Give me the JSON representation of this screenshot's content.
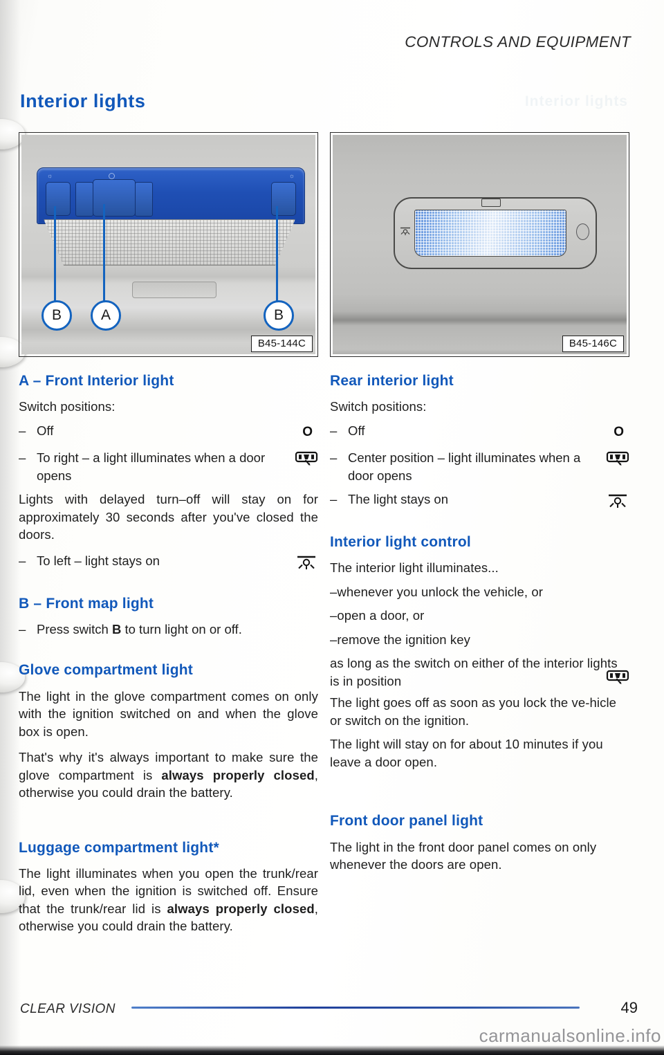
{
  "header": {
    "running_head": "CONTROLS AND EQUIPMENT",
    "ghost_text": "Interior lights"
  },
  "page_title": "Interior lights",
  "figures": {
    "left": {
      "caption": "B45-144C",
      "callouts": [
        {
          "label": "B"
        },
        {
          "label": "A"
        },
        {
          "label": "B"
        }
      ]
    },
    "right": {
      "caption": "B45-146C"
    }
  },
  "left_column": {
    "section_a": {
      "heading": "A – Front Interior light",
      "intro": "Switch positions:",
      "bullets": [
        {
          "dash": "–",
          "text": "Off",
          "symbol": "off-position-symbol",
          "symbol_char": "O"
        },
        {
          "dash": "–",
          "text": "To right – a light illuminates when a door opens",
          "symbol": "door-contact-switch-symbol"
        }
      ],
      "paragraph": "Lights with delayed turn–off will stay on for approximately 30 seconds after you've closed the doors.",
      "bullet_last": {
        "dash": "–",
        "text": "To left – light stays on",
        "symbol": "light-on-symbol"
      }
    },
    "section_b": {
      "heading": "B – Front map light",
      "bullet": {
        "dash": "–",
        "text_before": "Press switch ",
        "bold": "B",
        "text_after": " to turn light on or off."
      }
    },
    "section_glove": {
      "heading": "Glove compartment light",
      "paragraph_1": "The light in the glove compartment comes on only with the ignition switched on and when the glove box is open.",
      "paragraph_2_a": "That's why it's always important to make sure the glove compartment is ",
      "paragraph_2_bold": "always properly closed",
      "paragraph_2_b": ", otherwise you could drain the battery."
    },
    "section_luggage": {
      "heading": "Luggage compartment light*",
      "paragraph_a": "The light illuminates when you open the trunk/rear lid, even when the ignition is switched off. Ensure that the trunk/rear lid is ",
      "paragraph_bold": "always properly closed",
      "paragraph_b": ", otherwise you could drain the battery."
    }
  },
  "right_column": {
    "section_rear": {
      "heading": "Rear interior light",
      "intro": "Switch positions:",
      "bullets": [
        {
          "dash": "–",
          "text": "Off",
          "symbol": "off-position-symbol",
          "symbol_char": "O"
        },
        {
          "dash": "–",
          "text": "Center position – light illuminates when a door opens",
          "symbol": "door-contact-switch-symbol"
        },
        {
          "dash": "–",
          "text": "The light stays on",
          "symbol": "light-on-symbol"
        }
      ]
    },
    "section_control": {
      "heading": "Interior light control",
      "intro": "The interior light illuminates...",
      "items": [
        "–whenever you unlock the vehicle, or",
        "–open a door, or",
        "–remove the ignition key"
      ],
      "condition": "as long as the switch on either of the interior lights is in position",
      "paragraph_1": "The light goes off as soon as you lock the ve-hicle or switch on the ignition.",
      "paragraph_2": "The light will stay on for about 10 minutes if you leave a door open."
    },
    "section_door_panel": {
      "heading": "Front door panel light",
      "paragraph": "The light in the front door panel comes on only whenever the doors are open."
    }
  },
  "footer": {
    "label": "CLEAR VISION",
    "page_number": "49",
    "watermark": "carmanualsonline.info"
  },
  "colors": {
    "heading_blue": "#1158ba",
    "lamp_blue": "#1f4fb4",
    "rule_blue": "#21419b"
  }
}
